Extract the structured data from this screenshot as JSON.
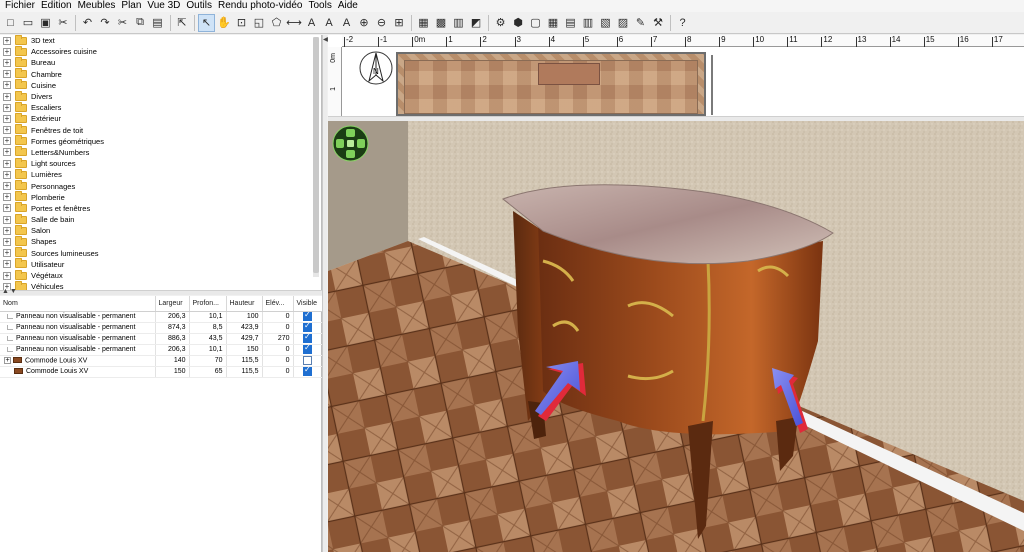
{
  "menu": [
    "Fichier",
    "Edition",
    "Meubles",
    "Plan",
    "Vue 3D",
    "Outils",
    "Rendu photo-vidéo",
    "Tools",
    "Aide"
  ],
  "toolbar": [
    {
      "icon": "new-home-icon",
      "glyph": "□"
    },
    {
      "icon": "open-icon",
      "glyph": "▭"
    },
    {
      "icon": "save-icon",
      "glyph": "▣"
    },
    {
      "icon": "cut-icon",
      "glyph": "✂"
    },
    {
      "sep": true
    },
    {
      "icon": "undo-icon",
      "glyph": "↶"
    },
    {
      "icon": "redo-icon",
      "glyph": "↷"
    },
    {
      "icon": "cut2-icon",
      "glyph": "✂"
    },
    {
      "icon": "copy-icon",
      "glyph": "⧉"
    },
    {
      "icon": "paste-icon",
      "glyph": "▤"
    },
    {
      "sep": true
    },
    {
      "icon": "add-furniture-icon",
      "glyph": "⇱"
    },
    {
      "sep": true
    },
    {
      "icon": "select-mode-icon",
      "glyph": "↖",
      "active": true
    },
    {
      "icon": "pan-mode-icon",
      "glyph": "✋"
    },
    {
      "icon": "create-walls-icon",
      "glyph": "⊡"
    },
    {
      "icon": "create-rooms-icon",
      "glyph": "◱"
    },
    {
      "icon": "create-polylines-icon",
      "glyph": "⬠"
    },
    {
      "icon": "create-dimensions-icon",
      "glyph": "⟷"
    },
    {
      "icon": "add-text-icon",
      "glyph": "A"
    },
    {
      "icon": "text-style-icon",
      "glyph": "A"
    },
    {
      "icon": "italic-icon",
      "glyph": "A"
    },
    {
      "icon": "zoom-in-icon",
      "glyph": "⊕"
    },
    {
      "icon": "zoom-out-icon",
      "glyph": "⊖"
    },
    {
      "icon": "zoom-fit-icon",
      "glyph": "⊞"
    },
    {
      "sep": true
    },
    {
      "icon": "photo-icon",
      "glyph": "▦"
    },
    {
      "icon": "video-icon",
      "glyph": "▩"
    },
    {
      "icon": "export-icon",
      "glyph": "▥"
    },
    {
      "icon": "plugin-icon",
      "glyph": "◩"
    },
    {
      "sep": true
    },
    {
      "icon": "render-icon",
      "glyph": "⚙"
    },
    {
      "icon": "material-icon",
      "glyph": "⬢"
    },
    {
      "icon": "texture-icon",
      "glyph": "▢"
    },
    {
      "icon": "grid-icon",
      "glyph": "▦"
    },
    {
      "icon": "layout-icon",
      "glyph": "▤"
    },
    {
      "icon": "print-icon",
      "glyph": "▥"
    },
    {
      "icon": "pdf-icon",
      "glyph": "▧"
    },
    {
      "icon": "image-icon",
      "glyph": "▨"
    },
    {
      "icon": "settings-icon",
      "glyph": "✎"
    },
    {
      "icon": "tools-icon",
      "glyph": "⚒"
    },
    {
      "sep": true
    },
    {
      "icon": "help-icon",
      "glyph": "?"
    }
  ],
  "catalog": [
    "3D text",
    "Accessoires cuisine",
    "Bureau",
    "Chambre",
    "Cuisine",
    "Divers",
    "Escaliers",
    "Extérieur",
    "Fenêtres de toit",
    "Formes géométriques",
    "Letters&Numbers",
    "Light sources",
    "Lumières",
    "Personnages",
    "Plomberie",
    "Portes et fenêtres",
    "Salle de bain",
    "Salon",
    "Shapes",
    "Sources lumineuses",
    "Utilisateur",
    "Végétaux",
    "Véhicules"
  ],
  "furniture": {
    "headers": [
      "Nom",
      "Largeur",
      "Profon...",
      "Hauteur",
      "Elév...",
      "Visible"
    ],
    "rows": [
      {
        "name": "Panneau non visualisable - permanent",
        "width": "206,3",
        "depth": "10,1",
        "height": "100",
        "elev": "0",
        "visible": true,
        "kind": "panel"
      },
      {
        "name": "Panneau non visualisable - permanent",
        "width": "874,3",
        "depth": "8,5",
        "height": "423,9",
        "elev": "0",
        "visible": true,
        "kind": "panel"
      },
      {
        "name": "Panneau non visualisable - permanent",
        "width": "886,3",
        "depth": "43,5",
        "height": "429,7",
        "elev": "270",
        "visible": true,
        "kind": "panel"
      },
      {
        "name": "Panneau non visualisable - permanent",
        "width": "206,3",
        "depth": "10,1",
        "height": "150",
        "elev": "0",
        "visible": true,
        "kind": "panel"
      },
      {
        "name": "Commode Louis XV",
        "width": "140",
        "depth": "70",
        "height": "115,5",
        "elev": "0",
        "visible": false,
        "kind": "commode-group"
      },
      {
        "name": "Commode Louis XV",
        "width": "150",
        "depth": "65",
        "height": "115,5",
        "elev": "0",
        "visible": true,
        "kind": "commode"
      }
    ]
  },
  "ruler": {
    "h_labels": [
      "-2",
      "-1",
      "0m",
      "1",
      "2",
      "3",
      "4",
      "5",
      "6",
      "7",
      "8",
      "9",
      "10",
      "11",
      "12",
      "13",
      "14",
      "15",
      "16",
      "17"
    ],
    "v_labels": [
      "0m",
      "1"
    ]
  },
  "colors": {
    "wall": "#d6cab8",
    "floor_dark": "#7a4a2c",
    "floor_light": "#b98a66",
    "marble": "#b59a95",
    "wood": "#8c4720",
    "arrow_blue": "#6a72e8",
    "arrow_red": "#e02a3a",
    "nav_green": "#6fc24a"
  }
}
